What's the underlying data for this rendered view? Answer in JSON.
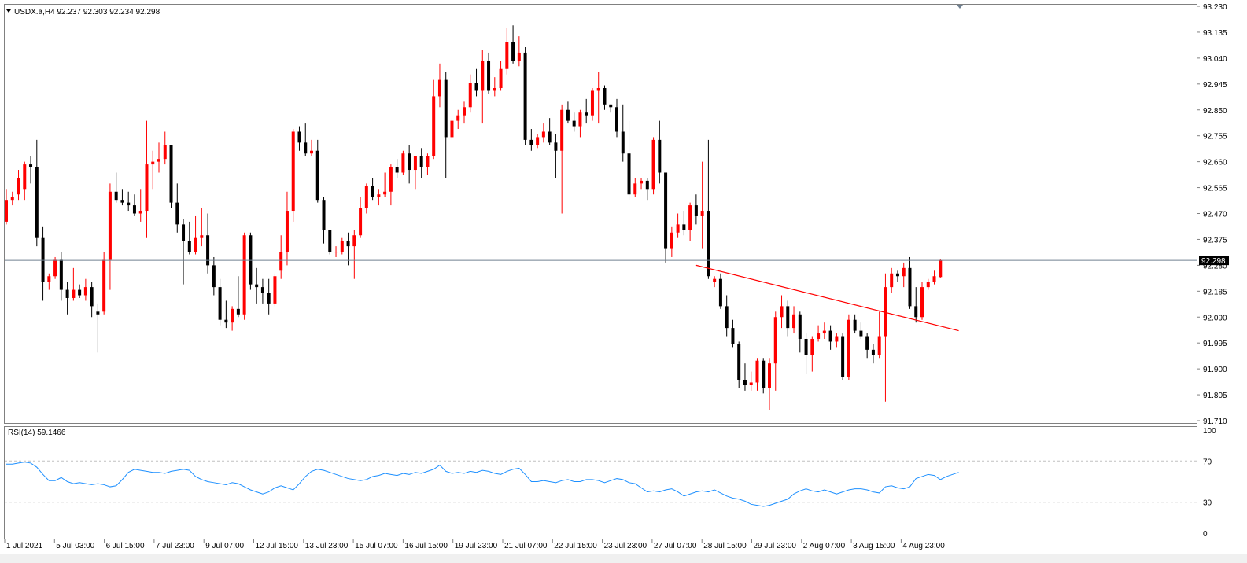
{
  "header": {
    "symbol_info": "USDX.a,H4  92.237 92.303 92.234 92.298",
    "dropdown_icon": "triangle-down-icon"
  },
  "chart_data": {
    "type": "candlestick",
    "symbol": "USDX.a",
    "timeframe": "H4",
    "price_axis": {
      "ticks": [
        "93.230",
        "93.135",
        "93.040",
        "92.945",
        "92.850",
        "92.755",
        "92.660",
        "92.565",
        "92.470",
        "92.375",
        "92.280",
        "92.185",
        "92.090",
        "91.995",
        "91.900",
        "91.805",
        "91.710"
      ],
      "range": [
        91.71,
        93.23
      ]
    },
    "current_price": "92.298",
    "time_axis": [
      "1 Jul 2021",
      "5 Jul 03:00",
      "6 Jul 15:00",
      "7 Jul 23:00",
      "9 Jul 07:00",
      "12 Jul 15:00",
      "13 Jul 23:00",
      "15 Jul 07:00",
      "16 Jul 15:00",
      "19 Jul 23:00",
      "21 Jul 07:00",
      "22 Jul 15:00",
      "23 Jul 23:00",
      "27 Jul 07:00",
      "28 Jul 15:00",
      "29 Jul 23:00",
      "2 Aug 07:00",
      "3 Aug 15:00",
      "4 Aug 23:00"
    ],
    "colors": {
      "up": "#ff0000",
      "down": "#000000",
      "trendline": "#ff0000",
      "rsi": "#1e90ff",
      "price_line": "#708090"
    },
    "candles": [
      {
        "o": 92.44,
        "h": 92.56,
        "l": 92.43,
        "c": 92.52
      },
      {
        "o": 92.52,
        "h": 92.55,
        "l": 92.5,
        "c": 92.53
      },
      {
        "o": 92.54,
        "h": 92.63,
        "l": 92.52,
        "c": 92.6
      },
      {
        "o": 92.56,
        "h": 92.66,
        "l": 92.52,
        "c": 92.65
      },
      {
        "o": 92.65,
        "h": 92.68,
        "l": 92.58,
        "c": 92.64
      },
      {
        "o": 92.64,
        "h": 92.74,
        "l": 92.35,
        "c": 92.38
      },
      {
        "o": 92.38,
        "h": 92.42,
        "l": 92.15,
        "c": 92.22
      },
      {
        "o": 92.22,
        "h": 92.25,
        "l": 92.19,
        "c": 92.24
      },
      {
        "o": 92.24,
        "h": 92.31,
        "l": 92.23,
        "c": 92.3
      },
      {
        "o": 92.3,
        "h": 92.33,
        "l": 92.15,
        "c": 92.19
      },
      {
        "o": 92.19,
        "h": 92.22,
        "l": 92.1,
        "c": 92.16
      },
      {
        "o": 92.16,
        "h": 92.27,
        "l": 92.15,
        "c": 92.19
      },
      {
        "o": 92.19,
        "h": 92.21,
        "l": 92.16,
        "c": 92.17
      },
      {
        "o": 92.17,
        "h": 92.23,
        "l": 92.15,
        "c": 92.2
      },
      {
        "o": 92.2,
        "h": 92.22,
        "l": 92.09,
        "c": 92.13
      },
      {
        "o": 92.11,
        "h": 92.14,
        "l": 91.96,
        "c": 92.1
      },
      {
        "o": 92.11,
        "h": 92.33,
        "l": 92.1,
        "c": 92.3
      },
      {
        "o": 92.3,
        "h": 92.58,
        "l": 92.19,
        "c": 92.55
      },
      {
        "o": 92.55,
        "h": 92.62,
        "l": 92.51,
        "c": 92.52
      },
      {
        "o": 92.52,
        "h": 92.56,
        "l": 92.5,
        "c": 92.51
      },
      {
        "o": 92.51,
        "h": 92.55,
        "l": 92.48,
        "c": 92.5
      },
      {
        "o": 92.5,
        "h": 92.54,
        "l": 92.46,
        "c": 92.47
      },
      {
        "o": 92.47,
        "h": 92.56,
        "l": 92.44,
        "c": 92.48
      },
      {
        "o": 92.48,
        "h": 92.81,
        "l": 92.38,
        "c": 92.65
      },
      {
        "o": 92.65,
        "h": 92.7,
        "l": 92.56,
        "c": 92.66
      },
      {
        "o": 92.66,
        "h": 92.73,
        "l": 92.62,
        "c": 92.67
      },
      {
        "o": 92.67,
        "h": 92.77,
        "l": 92.65,
        "c": 92.72
      },
      {
        "o": 92.72,
        "h": 92.72,
        "l": 92.49,
        "c": 92.51
      },
      {
        "o": 92.51,
        "h": 92.58,
        "l": 92.4,
        "c": 92.43
      },
      {
        "o": 92.43,
        "h": 92.45,
        "l": 92.21,
        "c": 92.37
      },
      {
        "o": 92.37,
        "h": 92.44,
        "l": 92.32,
        "c": 92.33
      },
      {
        "o": 92.33,
        "h": 92.46,
        "l": 92.32,
        "c": 92.38
      },
      {
        "o": 92.38,
        "h": 92.49,
        "l": 92.35,
        "c": 92.39
      },
      {
        "o": 92.39,
        "h": 92.47,
        "l": 92.25,
        "c": 92.28
      },
      {
        "o": 92.28,
        "h": 92.31,
        "l": 92.17,
        "c": 92.2
      },
      {
        "o": 92.2,
        "h": 92.23,
        "l": 92.06,
        "c": 92.08
      },
      {
        "o": 92.08,
        "h": 92.15,
        "l": 92.05,
        "c": 92.07
      },
      {
        "o": 92.07,
        "h": 92.13,
        "l": 92.04,
        "c": 92.12
      },
      {
        "o": 92.12,
        "h": 92.24,
        "l": 92.09,
        "c": 92.1
      },
      {
        "o": 92.1,
        "h": 92.4,
        "l": 92.08,
        "c": 92.39
      },
      {
        "o": 92.39,
        "h": 92.4,
        "l": 92.19,
        "c": 92.21
      },
      {
        "o": 92.21,
        "h": 92.27,
        "l": 92.14,
        "c": 92.2
      },
      {
        "o": 92.2,
        "h": 92.23,
        "l": 92.14,
        "c": 92.18
      },
      {
        "o": 92.18,
        "h": 92.23,
        "l": 92.1,
        "c": 92.14
      },
      {
        "o": 92.14,
        "h": 92.25,
        "l": 92.13,
        "c": 92.24
      },
      {
        "o": 92.26,
        "h": 92.39,
        "l": 92.23,
        "c": 92.33
      },
      {
        "o": 92.33,
        "h": 92.55,
        "l": 92.28,
        "c": 92.48
      },
      {
        "o": 92.48,
        "h": 92.78,
        "l": 92.44,
        "c": 92.77
      },
      {
        "o": 92.77,
        "h": 92.79,
        "l": 92.7,
        "c": 92.73
      },
      {
        "o": 92.73,
        "h": 92.8,
        "l": 92.68,
        "c": 92.69
      },
      {
        "o": 92.69,
        "h": 92.74,
        "l": 92.68,
        "c": 92.7
      },
      {
        "o": 92.7,
        "h": 92.74,
        "l": 92.51,
        "c": 92.52
      },
      {
        "o": 92.52,
        "h": 92.53,
        "l": 92.36,
        "c": 92.41
      },
      {
        "o": 92.41,
        "h": 92.41,
        "l": 92.32,
        "c": 92.33
      },
      {
        "o": 92.33,
        "h": 92.35,
        "l": 92.31,
        "c": 92.33
      },
      {
        "o": 92.33,
        "h": 92.38,
        "l": 92.32,
        "c": 92.37
      },
      {
        "o": 92.37,
        "h": 92.4,
        "l": 92.28,
        "c": 92.35
      },
      {
        "o": 92.35,
        "h": 92.41,
        "l": 92.23,
        "c": 92.39
      },
      {
        "o": 92.39,
        "h": 92.53,
        "l": 92.38,
        "c": 92.49
      },
      {
        "o": 92.49,
        "h": 92.58,
        "l": 92.47,
        "c": 92.57
      },
      {
        "o": 92.57,
        "h": 92.6,
        "l": 92.52,
        "c": 92.53
      },
      {
        "o": 92.53,
        "h": 92.56,
        "l": 92.5,
        "c": 92.54
      },
      {
        "o": 92.54,
        "h": 92.62,
        "l": 92.53,
        "c": 92.55
      },
      {
        "o": 92.55,
        "h": 92.65,
        "l": 92.5,
        "c": 92.64
      },
      {
        "o": 92.64,
        "h": 92.67,
        "l": 92.6,
        "c": 92.62
      },
      {
        "o": 92.62,
        "h": 92.7,
        "l": 92.61,
        "c": 92.69
      },
      {
        "o": 92.69,
        "h": 92.72,
        "l": 92.58,
        "c": 92.63
      },
      {
        "o": 92.63,
        "h": 92.68,
        "l": 92.56,
        "c": 92.68
      },
      {
        "o": 92.68,
        "h": 92.71,
        "l": 92.6,
        "c": 92.64
      },
      {
        "o": 92.64,
        "h": 92.69,
        "l": 92.61,
        "c": 92.68
      },
      {
        "o": 92.68,
        "h": 92.96,
        "l": 92.67,
        "c": 92.9
      },
      {
        "o": 92.9,
        "h": 93.02,
        "l": 92.86,
        "c": 92.96
      },
      {
        "o": 92.96,
        "h": 92.99,
        "l": 92.6,
        "c": 92.75
      },
      {
        "o": 92.75,
        "h": 92.82,
        "l": 92.74,
        "c": 92.81
      },
      {
        "o": 92.81,
        "h": 92.85,
        "l": 92.78,
        "c": 92.83
      },
      {
        "o": 92.83,
        "h": 92.88,
        "l": 92.8,
        "c": 92.86
      },
      {
        "o": 92.86,
        "h": 92.98,
        "l": 92.84,
        "c": 92.95
      },
      {
        "o": 92.95,
        "h": 93.0,
        "l": 92.9,
        "c": 92.92
      },
      {
        "o": 92.92,
        "h": 93.07,
        "l": 92.8,
        "c": 93.03
      },
      {
        "o": 93.03,
        "h": 93.06,
        "l": 92.91,
        "c": 92.92
      },
      {
        "o": 92.92,
        "h": 92.97,
        "l": 92.9,
        "c": 92.93
      },
      {
        "o": 92.93,
        "h": 93.03,
        "l": 92.92,
        "c": 93.0
      },
      {
        "o": 93.0,
        "h": 93.15,
        "l": 92.98,
        "c": 93.1
      },
      {
        "o": 93.1,
        "h": 93.16,
        "l": 93.02,
        "c": 93.03
      },
      {
        "o": 93.03,
        "h": 93.12,
        "l": 93.01,
        "c": 93.06
      },
      {
        "o": 93.06,
        "h": 93.08,
        "l": 92.72,
        "c": 92.74
      },
      {
        "o": 92.74,
        "h": 92.78,
        "l": 92.7,
        "c": 92.72
      },
      {
        "o": 92.72,
        "h": 92.76,
        "l": 92.71,
        "c": 92.75
      },
      {
        "o": 92.75,
        "h": 92.8,
        "l": 92.73,
        "c": 92.77
      },
      {
        "o": 92.77,
        "h": 92.82,
        "l": 92.72,
        "c": 92.73
      },
      {
        "o": 92.73,
        "h": 92.76,
        "l": 92.6,
        "c": 92.7
      },
      {
        "o": 92.7,
        "h": 92.87,
        "l": 92.47,
        "c": 92.85
      },
      {
        "o": 92.85,
        "h": 92.88,
        "l": 92.8,
        "c": 92.81
      },
      {
        "o": 92.81,
        "h": 92.84,
        "l": 92.77,
        "c": 92.79
      },
      {
        "o": 92.79,
        "h": 92.85,
        "l": 92.75,
        "c": 92.84
      },
      {
        "o": 92.84,
        "h": 92.89,
        "l": 92.8,
        "c": 92.83
      },
      {
        "o": 92.83,
        "h": 92.93,
        "l": 92.81,
        "c": 92.92
      },
      {
        "o": 92.92,
        "h": 92.99,
        "l": 92.8,
        "c": 92.93
      },
      {
        "o": 92.93,
        "h": 92.94,
        "l": 92.85,
        "c": 92.87
      },
      {
        "o": 92.87,
        "h": 92.87,
        "l": 92.84,
        "c": 92.86
      },
      {
        "o": 92.86,
        "h": 92.89,
        "l": 92.75,
        "c": 92.77
      },
      {
        "o": 92.77,
        "h": 92.87,
        "l": 92.66,
        "c": 92.69
      },
      {
        "o": 92.69,
        "h": 92.81,
        "l": 92.52,
        "c": 92.54
      },
      {
        "o": 92.54,
        "h": 92.6,
        "l": 92.53,
        "c": 92.58
      },
      {
        "o": 92.58,
        "h": 92.6,
        "l": 92.56,
        "c": 92.59
      },
      {
        "o": 92.59,
        "h": 92.6,
        "l": 92.52,
        "c": 92.56
      },
      {
        "o": 92.56,
        "h": 92.75,
        "l": 92.54,
        "c": 92.74
      },
      {
        "o": 92.74,
        "h": 92.81,
        "l": 92.58,
        "c": 92.62
      },
      {
        "o": 92.62,
        "h": 92.62,
        "l": 92.29,
        "c": 92.34
      },
      {
        "o": 92.34,
        "h": 92.42,
        "l": 92.31,
        "c": 92.4
      },
      {
        "o": 92.4,
        "h": 92.47,
        "l": 92.38,
        "c": 92.43
      },
      {
        "o": 92.43,
        "h": 92.48,
        "l": 92.39,
        "c": 92.41
      },
      {
        "o": 92.41,
        "h": 92.51,
        "l": 92.37,
        "c": 92.5
      },
      {
        "o": 92.5,
        "h": 92.54,
        "l": 92.43,
        "c": 92.46
      },
      {
        "o": 92.46,
        "h": 92.66,
        "l": 92.34,
        "c": 92.48
      },
      {
        "o": 92.48,
        "h": 92.74,
        "l": 92.23,
        "c": 92.24
      },
      {
        "o": 92.22,
        "h": 92.24,
        "l": 92.2,
        "c": 92.23
      },
      {
        "o": 92.23,
        "h": 92.25,
        "l": 92.12,
        "c": 92.13
      },
      {
        "o": 92.13,
        "h": 92.17,
        "l": 92.02,
        "c": 92.05
      },
      {
        "o": 92.05,
        "h": 92.08,
        "l": 91.98,
        "c": 91.99
      },
      {
        "o": 91.99,
        "h": 92.0,
        "l": 91.83,
        "c": 91.86
      },
      {
        "o": 91.86,
        "h": 91.92,
        "l": 91.82,
        "c": 91.84
      },
      {
        "o": 91.84,
        "h": 91.89,
        "l": 91.82,
        "c": 91.85
      },
      {
        "o": 91.85,
        "h": 91.94,
        "l": 91.82,
        "c": 91.93
      },
      {
        "o": 91.93,
        "h": 91.94,
        "l": 91.81,
        "c": 91.83
      },
      {
        "o": 91.83,
        "h": 91.94,
        "l": 91.75,
        "c": 91.92
      },
      {
        "o": 91.92,
        "h": 92.11,
        "l": 91.82,
        "c": 92.09
      },
      {
        "o": 92.09,
        "h": 92.17,
        "l": 92.05,
        "c": 92.13
      },
      {
        "o": 92.13,
        "h": 92.15,
        "l": 92.02,
        "c": 92.05
      },
      {
        "o": 92.05,
        "h": 92.13,
        "l": 92.03,
        "c": 92.1
      },
      {
        "o": 92.1,
        "h": 92.11,
        "l": 91.96,
        "c": 92.01
      },
      {
        "o": 92.01,
        "h": 92.03,
        "l": 91.88,
        "c": 91.95
      },
      {
        "o": 91.95,
        "h": 92.02,
        "l": 91.89,
        "c": 92.01
      },
      {
        "o": 92.01,
        "h": 92.06,
        "l": 92.0,
        "c": 92.03
      },
      {
        "o": 92.03,
        "h": 92.07,
        "l": 92.01,
        "c": 92.04
      },
      {
        "o": 92.04,
        "h": 92.06,
        "l": 91.97,
        "c": 92.0
      },
      {
        "o": 92.0,
        "h": 92.03,
        "l": 91.98,
        "c": 92.02
      },
      {
        "o": 92.02,
        "h": 92.03,
        "l": 91.86,
        "c": 91.87
      },
      {
        "o": 91.87,
        "h": 92.1,
        "l": 91.86,
        "c": 92.08
      },
      {
        "o": 92.08,
        "h": 92.1,
        "l": 92.03,
        "c": 92.04
      },
      {
        "o": 92.04,
        "h": 92.07,
        "l": 92.01,
        "c": 92.02
      },
      {
        "o": 92.02,
        "h": 92.03,
        "l": 91.94,
        "c": 91.97
      },
      {
        "o": 91.97,
        "h": 91.99,
        "l": 91.92,
        "c": 91.95
      },
      {
        "o": 91.95,
        "h": 92.11,
        "l": 91.94,
        "c": 92.02
      },
      {
        "o": 92.02,
        "h": 92.25,
        "l": 91.78,
        "c": 92.2
      },
      {
        "o": 92.2,
        "h": 92.27,
        "l": 92.18,
        "c": 92.25
      },
      {
        "o": 92.25,
        "h": 92.26,
        "l": 92.22,
        "c": 92.24
      },
      {
        "o": 92.24,
        "h": 92.29,
        "l": 92.2,
        "c": 92.27
      },
      {
        "o": 92.27,
        "h": 92.31,
        "l": 92.12,
        "c": 92.13
      },
      {
        "o": 92.13,
        "h": 92.2,
        "l": 92.07,
        "c": 92.09
      },
      {
        "o": 92.09,
        "h": 92.22,
        "l": 92.08,
        "c": 92.2
      },
      {
        "o": 92.2,
        "h": 92.23,
        "l": 92.19,
        "c": 92.22
      },
      {
        "o": 92.22,
        "h": 92.26,
        "l": 92.21,
        "c": 92.24
      },
      {
        "o": 92.237,
        "h": 92.303,
        "l": 92.234,
        "c": 92.298
      }
    ],
    "trendline": [
      {
        "candle_index": 113,
        "price": 92.28
      },
      {
        "candle_index": 156,
        "price": 92.04
      }
    ],
    "indicator": {
      "label": "RSI(14) 59.1466",
      "levels": [
        70,
        30
      ],
      "axis_ticks": [
        "100",
        "70",
        "30",
        "0"
      ],
      "values": [
        67,
        67,
        68,
        69,
        68,
        64,
        57,
        51,
        51,
        54,
        50,
        48,
        49,
        48,
        47,
        48,
        47,
        45,
        46,
        52,
        59,
        62,
        61,
        60,
        59,
        59,
        58,
        60,
        61,
        62,
        61,
        55,
        52,
        50,
        49,
        48,
        47,
        49,
        48,
        45,
        42,
        40,
        38,
        40,
        44,
        46,
        44,
        42,
        48,
        55,
        60,
        62,
        61,
        59,
        57,
        55,
        53,
        52,
        51,
        52,
        55,
        56,
        58,
        57,
        56,
        58,
        57,
        59,
        58,
        60,
        62,
        66,
        60,
        58,
        59,
        58,
        60,
        59,
        61,
        60,
        58,
        57,
        60,
        62,
        63,
        57,
        50,
        50,
        51,
        50,
        49,
        51,
        52,
        50,
        50,
        52,
        52,
        51,
        49,
        51,
        53,
        52,
        49,
        48,
        44,
        40,
        41,
        40,
        42,
        43,
        40,
        36,
        38,
        40,
        41,
        40,
        42,
        39,
        36,
        34,
        33,
        31,
        28,
        27,
        26,
        27,
        29,
        31,
        33,
        38,
        41,
        43,
        41,
        40,
        42,
        40,
        38,
        40,
        42,
        43,
        43,
        42,
        40,
        39,
        45,
        46,
        44,
        43,
        45,
        53,
        55,
        57,
        56,
        52,
        55,
        57,
        59
      ],
      "range": [
        0,
        100
      ]
    }
  }
}
